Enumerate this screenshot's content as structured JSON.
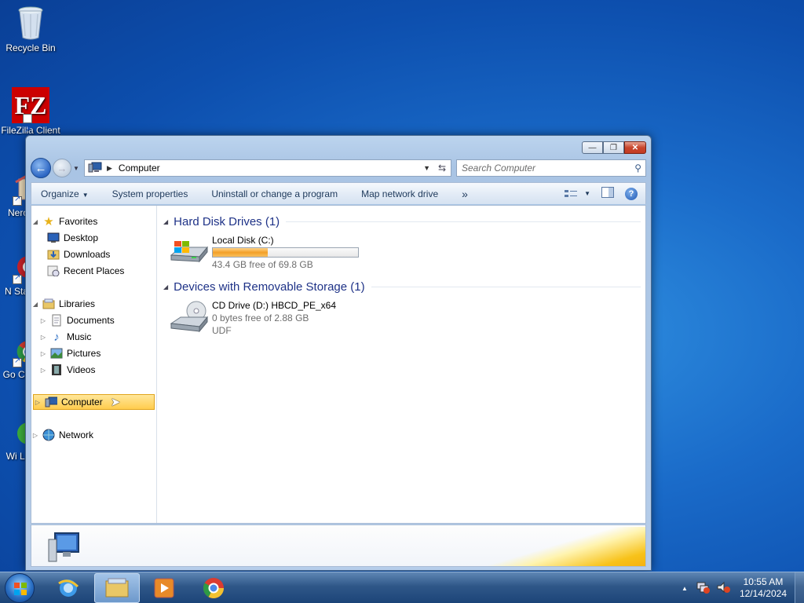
{
  "desktop": {
    "icons": [
      {
        "label": "Recycle Bin"
      },
      {
        "label": "FileZilla Client"
      },
      {
        "label": "Nero"
      },
      {
        "label": "N Star"
      },
      {
        "label": "Go Chr"
      },
      {
        "label": "Wi Lo"
      }
    ]
  },
  "window": {
    "caption": {
      "min": "—",
      "max": "❐",
      "close": "✕"
    },
    "address": {
      "location": "Computer",
      "refresh_icon": "refresh-icon"
    },
    "search": {
      "placeholder": "Search Computer"
    },
    "toolbar": {
      "organize": "Organize",
      "system_properties": "System properties",
      "uninstall": "Uninstall or change a program",
      "map_drive": "Map network drive",
      "more": "»"
    },
    "nav": {
      "favorites": "Favorites",
      "desktop": "Desktop",
      "downloads": "Downloads",
      "recent": "Recent Places",
      "libraries": "Libraries",
      "documents": "Documents",
      "music": "Music",
      "pictures": "Pictures",
      "videos": "Videos",
      "computer": "Computer",
      "network": "Network"
    },
    "groups": {
      "hdd": {
        "title": "Hard Disk Drives (1)",
        "drives": [
          {
            "name": "Local Disk (C:)",
            "free_text": "43.4 GB free of 69.8 GB",
            "used_fraction": 0.378
          }
        ]
      },
      "removable": {
        "title": "Devices with Removable Storage (1)",
        "drives": [
          {
            "name": "CD Drive (D:) HBCD_PE_x64",
            "free_text": "0 bytes free of 2.88 GB",
            "fs": "UDF"
          }
        ]
      }
    }
  },
  "taskbar": {
    "clock_time": "10:55 AM",
    "clock_date": "12/14/2024",
    "tray_up": "▲"
  }
}
